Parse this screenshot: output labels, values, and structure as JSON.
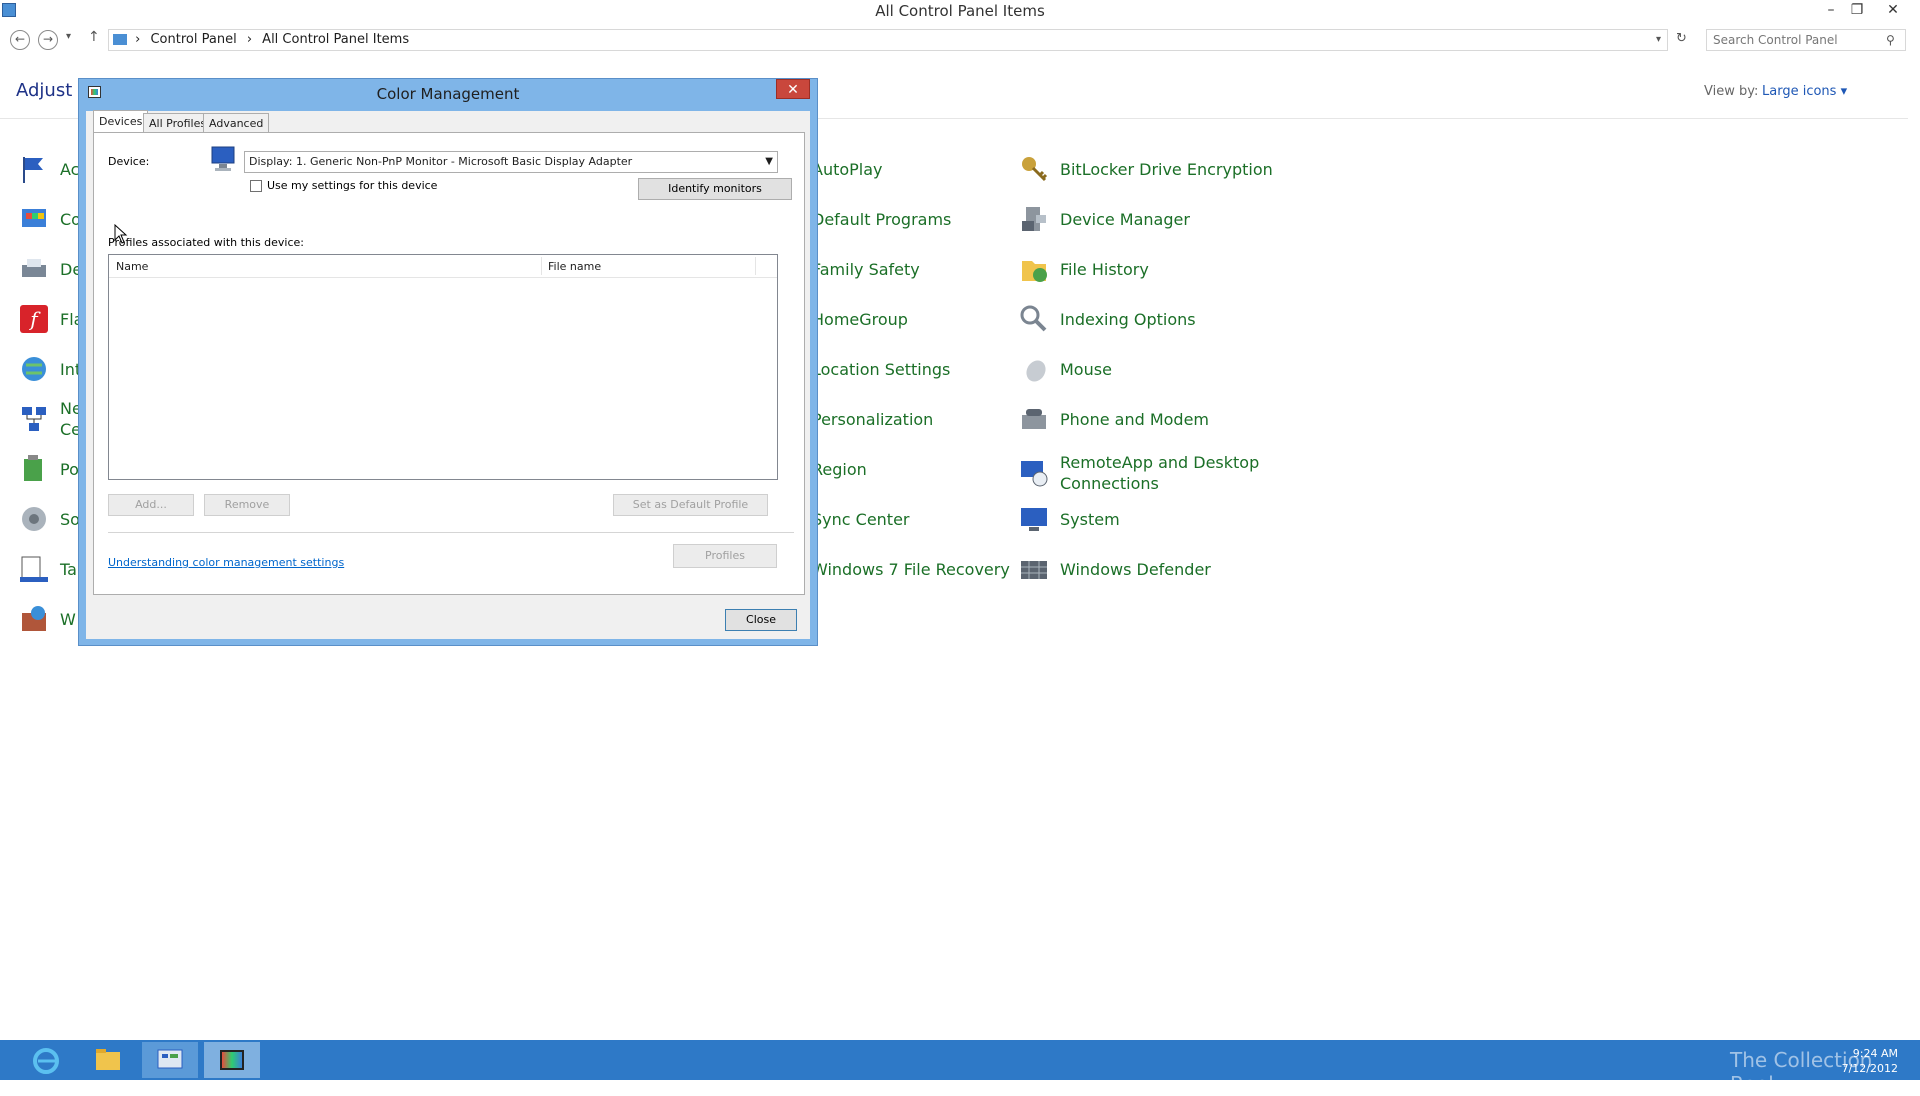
{
  "window": {
    "title": "All Control Panel Items",
    "min": "–",
    "restore": "❐",
    "close": "✕"
  },
  "address": {
    "crumbs": [
      "Control Panel",
      "All Control Panel Items"
    ],
    "sep": "›",
    "search_placeholder": "Search Control Panel"
  },
  "header": {
    "adjust_text": "Adjust yo",
    "view_by_label": "View by:",
    "view_by_value": "Large icons ▾"
  },
  "items_col1": [
    "Ac",
    "Co",
    "De",
    "Fla",
    "Int",
    "Ne\nCe",
    "Po",
    "So",
    "Ta",
    "W"
  ],
  "items_col2": [
    "AutoPlay",
    "Default Programs",
    "Family Safety",
    "HomeGroup",
    "Location Settings",
    "Personalization",
    "Region",
    "Sync Center",
    "Windows 7 File Recovery"
  ],
  "items_col3": [
    "BitLocker Drive Encryption",
    "Device Manager",
    "File History",
    "Indexing Options",
    "Mouse",
    "Phone and Modem",
    "RemoteApp and Desktop\nConnections",
    "System",
    "Windows Defender"
  ],
  "dialog": {
    "title": "Color Management",
    "close_x": "✕",
    "tabs": [
      "Devices",
      "All Profiles",
      "Advanced"
    ],
    "device_label": "Device:",
    "device_value": "Display: 1. Generic Non-PnP Monitor - Microsoft Basic Display Adapter",
    "use_my_settings": "Use my settings for this device",
    "identify_button": "Identify monitors",
    "profiles_label": "Profiles associated with this device:",
    "columns": [
      "Name",
      "File name"
    ],
    "add_button": "Add...",
    "remove_button": "Remove",
    "set_default_button": "Set as Default Profile",
    "profiles_button": "Profiles",
    "link": "Understanding color management settings",
    "close_button": "Close"
  },
  "taskbar": {
    "time": "9:24 AM",
    "date": "7/12/2012",
    "watermark": "The Collection Book"
  },
  "colors": {
    "accent": "#2e79c7",
    "item_text": "#1b6f27",
    "dialog_frame": "#7fb5e8"
  }
}
